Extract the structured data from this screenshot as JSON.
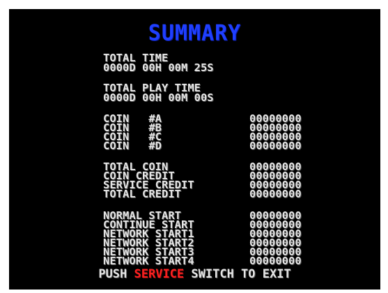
{
  "title": "SUMMARY",
  "total_time": {
    "label": "TOTAL TIME",
    "value": "0000D 00H 00M 25S"
  },
  "total_play_time": {
    "label": "TOTAL PLAY TIME",
    "value": "0000D 00H 00M 00S"
  },
  "coins": [
    {
      "label": "COIN   #A",
      "value": "00000000"
    },
    {
      "label": "COIN   #B",
      "value": "00000000"
    },
    {
      "label": "COIN   #C",
      "value": "00000000"
    },
    {
      "label": "COIN   #D",
      "value": "00000000"
    }
  ],
  "credits": [
    {
      "label": "TOTAL COIN",
      "value": "00000000"
    },
    {
      "label": "COIN CREDIT",
      "value": "00000000"
    },
    {
      "label": "SERVICE CREDIT",
      "value": "00000000"
    },
    {
      "label": "TOTAL CREDIT",
      "value": "00000000"
    }
  ],
  "starts": [
    {
      "label": "NORMAL START",
      "value": "00000000"
    },
    {
      "label": "CONTINUE START",
      "value": "00000000"
    },
    {
      "label": "NETWORK START1",
      "value": "00000000"
    },
    {
      "label": "NETWORK START2",
      "value": "00000000"
    },
    {
      "label": "NETWORK START3",
      "value": "00000000"
    },
    {
      "label": "NETWORK START4",
      "value": "00000000"
    }
  ],
  "footer": {
    "prefix": "PUSH ",
    "service": "SERVICE",
    "suffix": " SWITCH TO EXIT"
  },
  "colors": {
    "background": "#000000",
    "text": "#e6e6e6",
    "title": "#1f3fff",
    "service": "#ff2020"
  }
}
